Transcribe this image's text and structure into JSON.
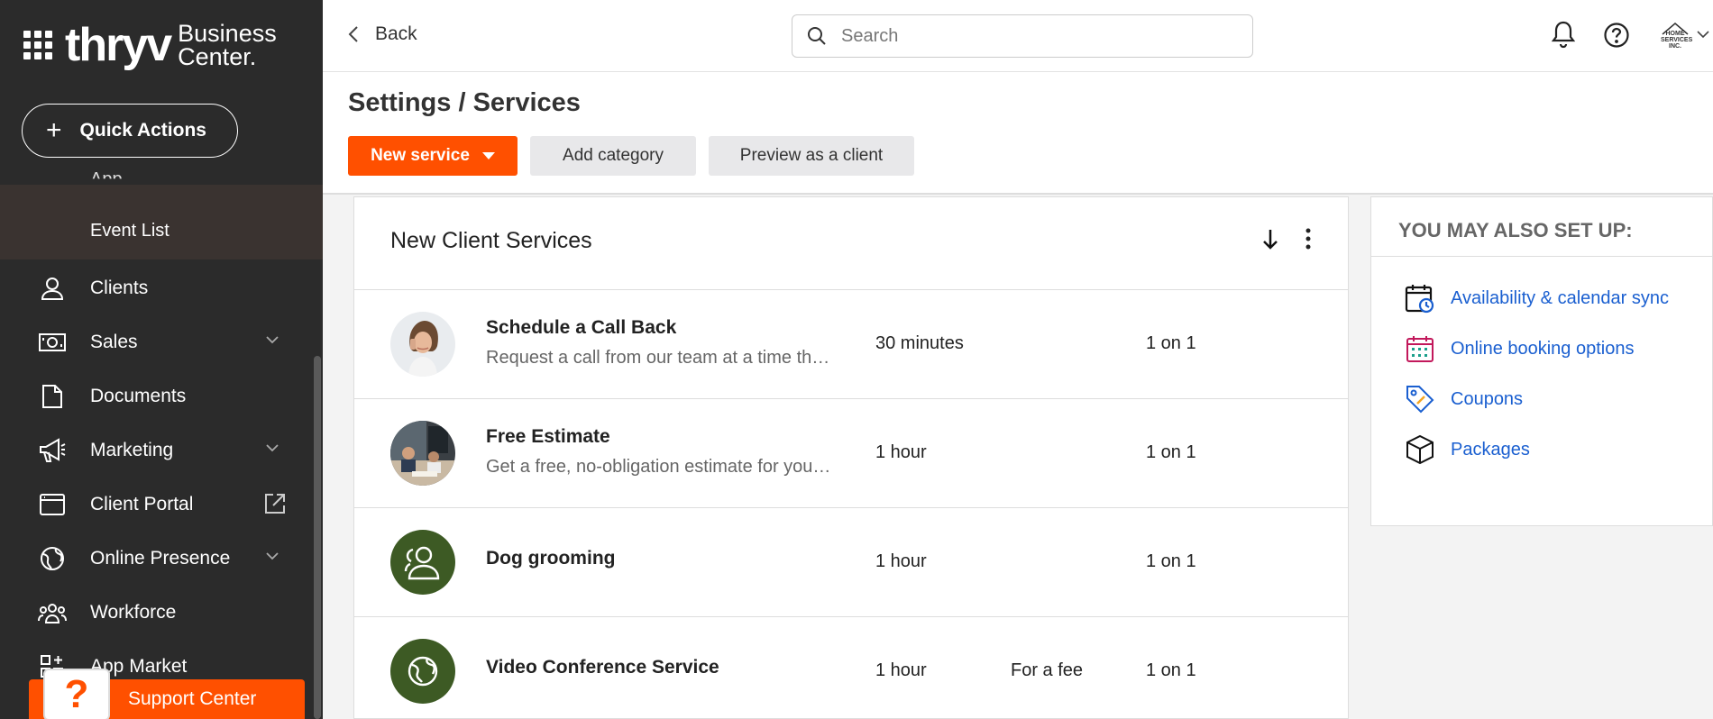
{
  "brand": {
    "logo": "thryv",
    "subtitle_line1": "Business",
    "subtitle_line2": "Center."
  },
  "quick_actions": {
    "label": "Quick Actions"
  },
  "sidebar": {
    "partial_item": "App",
    "sub_item": "Event List",
    "items": [
      {
        "label": "Clients",
        "icon": "user-icon"
      },
      {
        "label": "Sales",
        "icon": "money-icon"
      },
      {
        "label": "Documents",
        "icon": "document-icon"
      },
      {
        "label": "Marketing",
        "icon": "megaphone-icon"
      },
      {
        "label": "Client Portal",
        "icon": "window-icon"
      },
      {
        "label": "Online Presence",
        "icon": "globe-icon"
      },
      {
        "label": "Workforce",
        "icon": "team-icon"
      },
      {
        "label": "App Market",
        "icon": "apps-icon"
      }
    ]
  },
  "support": {
    "label": "Support Center"
  },
  "topbar": {
    "back_label": "Back",
    "search_placeholder": "Search",
    "avatar_text": "HOME SERVICES INC."
  },
  "page": {
    "title": "Settings / Services",
    "new_service_label": "New service",
    "add_category_label": "Add category",
    "preview_label": "Preview as a client"
  },
  "services_card": {
    "title": "New Client Services",
    "rows": [
      {
        "name": "Schedule a Call Back",
        "description": "Request a call from our team at a time that works for you",
        "duration": "30 minutes",
        "fee": "",
        "type": "1 on 1"
      },
      {
        "name": "Free Estimate",
        "description": "Get a free, no-obligation estimate for your project",
        "duration": "1 hour",
        "fee": "",
        "type": "1 on 1"
      },
      {
        "name": "Dog grooming",
        "description": "",
        "duration": "1 hour",
        "fee": "",
        "type": "1 on 1"
      },
      {
        "name": "Video Conference Service",
        "description": "",
        "duration": "1 hour",
        "fee": "For a fee",
        "type": "1 on 1"
      }
    ]
  },
  "side_panel": {
    "title": "YOU MAY ALSO SET UP:",
    "items": [
      {
        "label": "Availability & calendar sync",
        "icon": "calendar-sync-icon"
      },
      {
        "label": "Online booking options",
        "icon": "calendar-grid-icon"
      },
      {
        "label": "Coupons",
        "icon": "coupon-tag-icon"
      },
      {
        "label": "Packages",
        "icon": "package-box-icon"
      }
    ]
  },
  "colors": {
    "accent": "#ff5000",
    "sidebar_bg": "#2b2b2b",
    "link": "#1a5fd0",
    "avatar_green": "#3d5a24"
  }
}
